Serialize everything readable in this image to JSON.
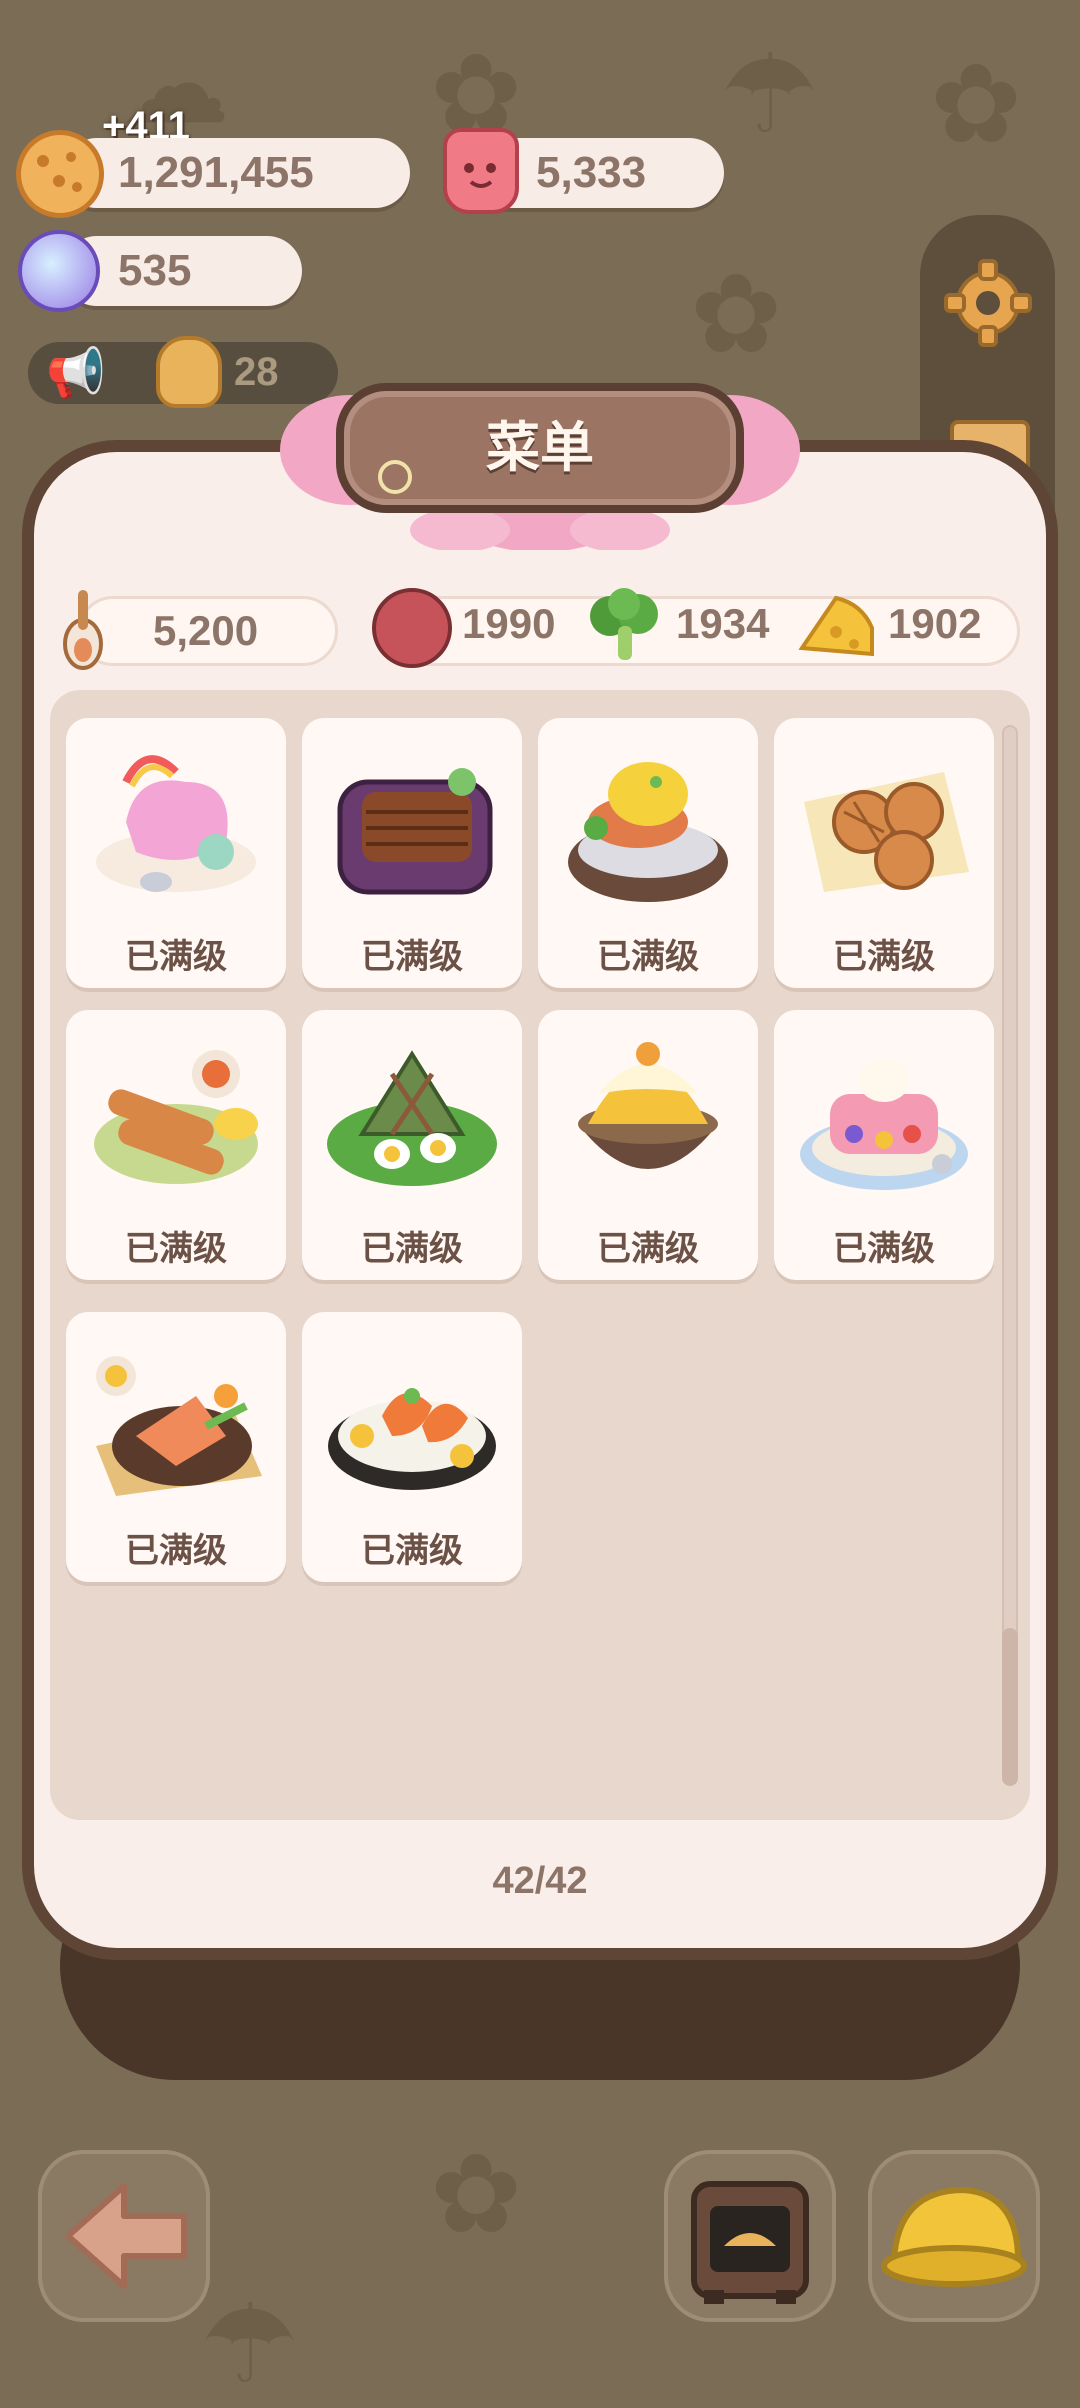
{
  "currencies": {
    "gain": "+411",
    "cookies": "1,291,455",
    "jelly": "5,333",
    "candy": "535",
    "notice_count": "28"
  },
  "menu": {
    "title": "菜单",
    "resources": {
      "spoon": "5,200",
      "meat": "1990",
      "veg": "1934",
      "cheese": "1902"
    },
    "status": "已满级",
    "counter": "42/42",
    "dishes": [
      {
        "name": "rainbow-cake"
      },
      {
        "name": "eel-rice-box"
      },
      {
        "name": "eggs-benedict"
      },
      {
        "name": "lattice-pies"
      },
      {
        "name": "chicken-skewers"
      },
      {
        "name": "leaf-wrapped-rice"
      },
      {
        "name": "mango-shaved-ice"
      },
      {
        "name": "fruit-jelly-cake"
      },
      {
        "name": "grilled-salmon"
      },
      {
        "name": "shrimp-rice-plate"
      }
    ]
  },
  "colors": {
    "background": "#7b6c55",
    "dialog": "#f9eee9",
    "ribbon": "#f2a8c4",
    "plaque": "#9c7464"
  },
  "icons": [
    "cookie-icon",
    "jelly-icon",
    "candy-icon",
    "megaphone-icon",
    "settings-gear-icon",
    "spoon-icon",
    "meat-icon",
    "broccoli-icon",
    "cheese-icon",
    "back-arrow-icon",
    "oven-icon",
    "helmet-icon"
  ]
}
